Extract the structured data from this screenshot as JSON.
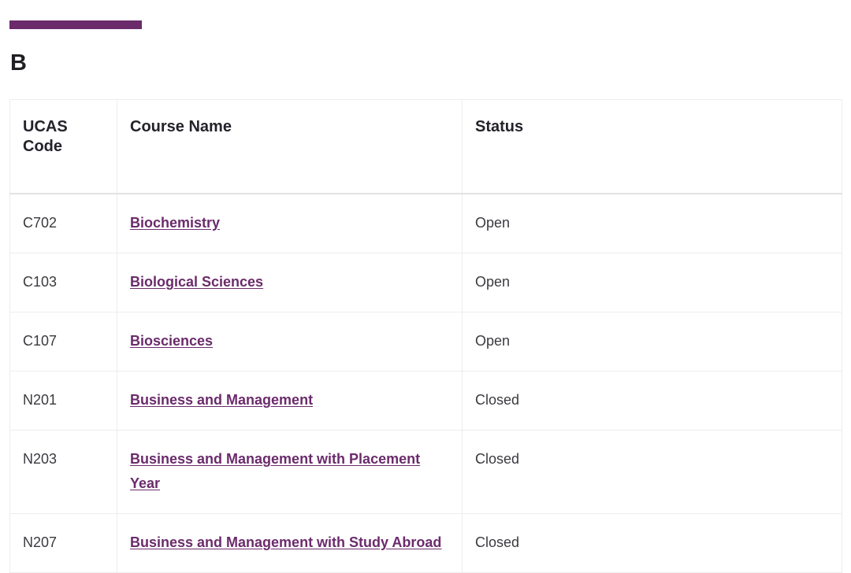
{
  "accent_color": "#6b2b6b",
  "link_color": "#6b2b6b",
  "text_color": "#3a3a40",
  "heading_color": "#1f1f24",
  "border_color": "#ededed",
  "section": {
    "heading": "B"
  },
  "table": {
    "columns": [
      {
        "key": "ucas_code",
        "label": "UCAS\nCode"
      },
      {
        "key": "course_name",
        "label": "Course Name"
      },
      {
        "key": "status",
        "label": "Status"
      }
    ],
    "rows": [
      {
        "ucas_code": "C702",
        "course_name": "Biochemistry",
        "status": "Open"
      },
      {
        "ucas_code": "C103",
        "course_name": "Biological Sciences",
        "status": "Open"
      },
      {
        "ucas_code": "C107",
        "course_name": "Biosciences",
        "status": "Open"
      },
      {
        "ucas_code": "N201",
        "course_name": "Business and Management",
        "status": "Closed"
      },
      {
        "ucas_code": "N203",
        "course_name": "Business and Management with Placement Year",
        "status": "Closed"
      },
      {
        "ucas_code": "N207",
        "course_name": "Business and Management with Study Abroad",
        "status": "Closed"
      }
    ]
  }
}
